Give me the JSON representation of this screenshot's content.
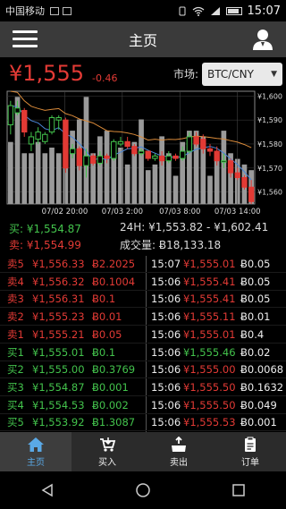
{
  "status": {
    "carrier": "中国移动",
    "time": "15:07"
  },
  "header": {
    "title": "主页"
  },
  "ticker": {
    "price": "¥1,555",
    "change": "-0.46",
    "market_label": "市场:",
    "market_value": "BTC/CNY"
  },
  "colors": {
    "up": "#43c34c",
    "down": "#e23a35",
    "accent": "#5aa9e6"
  },
  "chart_data": {
    "type": "candlestick",
    "y_ticks": [
      "¥1,600",
      "¥1,590",
      "¥1,580",
      "¥1,570",
      "¥1,560"
    ],
    "ylim": [
      1555,
      1602
    ],
    "x_labels": [
      "07/02 20:00",
      "07/03 2:00",
      "07/03 8:00",
      "07/03 14:00"
    ],
    "volumes": [
      0.55,
      0.95,
      0.45,
      0.45,
      0.55,
      0.45,
      0.5,
      0.45,
      0.55,
      0.65,
      0.75,
      0.95,
      0.45,
      0.6,
      0.65,
      0.55,
      0.5,
      0.35,
      0.55,
      0.75,
      0.3,
      0.35,
      0.6,
      0.45,
      0.25,
      0.55,
      0.65,
      0.65,
      0.6,
      0.25,
      0.45,
      0.65,
      0.45,
      0.4,
      0.35,
      0.3
    ],
    "candles": [
      {
        "o": 1588,
        "c": 1596,
        "h": 1598,
        "l": 1584
      },
      {
        "o": 1593,
        "c": 1595,
        "h": 1598,
        "l": 1592
      },
      {
        "o": 1594,
        "c": 1585,
        "h": 1595,
        "l": 1583
      },
      {
        "o": 1580,
        "c": 1583,
        "h": 1585,
        "l": 1577
      },
      {
        "o": 1582,
        "c": 1585,
        "h": 1587,
        "l": 1580
      },
      {
        "o": 1581,
        "c": 1584,
        "h": 1585,
        "l": 1580
      },
      {
        "o": 1585,
        "c": 1591,
        "h": 1592,
        "l": 1584
      },
      {
        "o": 1590,
        "c": 1591,
        "h": 1592,
        "l": 1586
      },
      {
        "o": 1590,
        "c": 1570,
        "h": 1591,
        "l": 1568
      },
      {
        "o": 1576,
        "c": 1578,
        "h": 1580,
        "l": 1574
      },
      {
        "o": 1578,
        "c": 1571,
        "h": 1579,
        "l": 1569
      },
      {
        "o": 1571,
        "c": 1575,
        "h": 1578,
        "l": 1566
      },
      {
        "o": 1575,
        "c": 1572,
        "h": 1576,
        "l": 1571
      },
      {
        "o": 1572,
        "c": 1575,
        "h": 1577,
        "l": 1571
      },
      {
        "o": 1575,
        "c": 1574,
        "h": 1576,
        "l": 1572
      },
      {
        "o": 1574,
        "c": 1581,
        "h": 1582,
        "l": 1573
      },
      {
        "o": 1580,
        "c": 1581,
        "h": 1583,
        "l": 1579
      },
      {
        "o": 1581,
        "c": 1579,
        "h": 1583,
        "l": 1578
      },
      {
        "o": 1579,
        "c": 1576,
        "h": 1580,
        "l": 1575
      },
      {
        "o": 1576,
        "c": 1577,
        "h": 1578,
        "l": 1575
      },
      {
        "o": 1577,
        "c": 1574,
        "h": 1577,
        "l": 1573
      },
      {
        "o": 1574,
        "c": 1575,
        "h": 1576,
        "l": 1573
      },
      {
        "o": 1575,
        "c": 1573,
        "h": 1577,
        "l": 1571
      },
      {
        "o": 1573,
        "c": 1575,
        "h": 1577,
        "l": 1572
      },
      {
        "o": 1575,
        "c": 1574,
        "h": 1576,
        "l": 1573
      },
      {
        "o": 1574,
        "c": 1577,
        "h": 1579,
        "l": 1573
      },
      {
        "o": 1577,
        "c": 1583,
        "h": 1585,
        "l": 1576
      },
      {
        "o": 1583,
        "c": 1580,
        "h": 1585,
        "l": 1579
      },
      {
        "o": 1582,
        "c": 1578,
        "h": 1584,
        "l": 1576
      },
      {
        "o": 1578,
        "c": 1577,
        "h": 1580,
        "l": 1575
      },
      {
        "o": 1577,
        "c": 1573,
        "h": 1579,
        "l": 1571
      },
      {
        "o": 1573,
        "c": 1573,
        "h": 1576,
        "l": 1570
      },
      {
        "o": 1573,
        "c": 1568,
        "h": 1574,
        "l": 1566
      },
      {
        "o": 1568,
        "c": 1566,
        "h": 1570,
        "l": 1565
      },
      {
        "o": 1566,
        "c": 1562,
        "h": 1567,
        "l": 1561
      },
      {
        "o": 1562,
        "c": 1556,
        "h": 1565,
        "l": 1555
      }
    ]
  },
  "stats": {
    "buy": "买: ¥1,554.87",
    "sell": "卖: ¥1,554.99",
    "range": "24H: ¥1,553.82 - ¥1,602.41",
    "volume": "成交量: Ƀ18,133.18"
  },
  "orderbook": [
    {
      "label": "卖5",
      "price": "¥1,556.33",
      "amount": "Ƀ2.2025",
      "side": "sell"
    },
    {
      "label": "卖4",
      "price": "¥1,556.32",
      "amount": "Ƀ0.1004",
      "side": "sell"
    },
    {
      "label": "卖3",
      "price": "¥1,556.31",
      "amount": "Ƀ0.1",
      "side": "sell"
    },
    {
      "label": "卖2",
      "price": "¥1,555.23",
      "amount": "Ƀ0.01",
      "side": "sell"
    },
    {
      "label": "卖1",
      "price": "¥1,555.21",
      "amount": "Ƀ0.05",
      "side": "sell"
    },
    {
      "label": "买1",
      "price": "¥1,555.01",
      "amount": "Ƀ0.1",
      "side": "buy"
    },
    {
      "label": "买2",
      "price": "¥1,555.00",
      "amount": "Ƀ0.3769",
      "side": "buy"
    },
    {
      "label": "买3",
      "price": "¥1,554.87",
      "amount": "Ƀ0.001",
      "side": "buy"
    },
    {
      "label": "买4",
      "price": "¥1,554.53",
      "amount": "Ƀ0.002",
      "side": "buy"
    },
    {
      "label": "买5",
      "price": "¥1,553.92",
      "amount": "Ƀ1.3087",
      "side": "buy"
    }
  ],
  "trades": [
    {
      "time": "15:07",
      "price": "¥1,555.01",
      "amount": "Ƀ0.05",
      "side": "sell"
    },
    {
      "time": "15:06",
      "price": "¥1,555.41",
      "amount": "Ƀ0.05",
      "side": "sell"
    },
    {
      "time": "15:06",
      "price": "¥1,555.41",
      "amount": "Ƀ0.05",
      "side": "sell"
    },
    {
      "time": "15:06",
      "price": "¥1,555.11",
      "amount": "Ƀ0.01",
      "side": "sell"
    },
    {
      "time": "15:06",
      "price": "¥1,555.01",
      "amount": "Ƀ0.4",
      "side": "sell"
    },
    {
      "time": "15:06",
      "price": "¥1,555.46",
      "amount": "Ƀ0.02",
      "side": "buy"
    },
    {
      "time": "15:06",
      "price": "¥1,555.00",
      "amount": "Ƀ0.0068",
      "side": "sell"
    },
    {
      "time": "15:06",
      "price": "¥1,555.50",
      "amount": "Ƀ0.1632",
      "side": "sell"
    },
    {
      "time": "15:06",
      "price": "¥1,555.50",
      "amount": "Ƀ0.049",
      "side": "sell"
    },
    {
      "time": "15:06",
      "price": "¥1,555.53",
      "amount": "Ƀ0.001",
      "side": "sell"
    }
  ],
  "tabs": [
    {
      "label": "主页",
      "icon": "home-icon",
      "active": true
    },
    {
      "label": "买入",
      "icon": "buy-icon",
      "active": false
    },
    {
      "label": "卖出",
      "icon": "sell-icon",
      "active": false
    },
    {
      "label": "订单",
      "icon": "orders-icon",
      "active": false
    }
  ]
}
